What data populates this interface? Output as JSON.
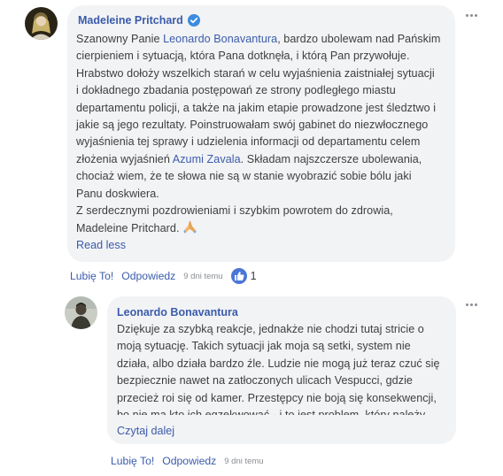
{
  "comment1": {
    "author": "Madeleine Pritchard",
    "lines": [
      {
        "segments": [
          {
            "text": "Szanowny Panie "
          },
          {
            "text": "Leonardo Bonavantura",
            "mention": true
          },
          {
            "text": ", bardzo ubolewam nad Pańskim"
          }
        ]
      },
      {
        "segments": [
          {
            "text": "cierpieniem i sytuacją, która Pana dotknęła, i którą Pan przywołuje."
          }
        ]
      },
      {
        "segments": [
          {
            "text": "Hrabstwo dołoży wszelkich starań w celu wyjaśnienia zaistniałej sytuacji"
          }
        ]
      },
      {
        "segments": [
          {
            "text": "i dokładnego zbadania postępowań ze strony podległego miastu"
          }
        ]
      },
      {
        "segments": [
          {
            "text": "departamentu policji, a także na jakim etapie prowadzone jest śledztwo i"
          }
        ]
      },
      {
        "segments": [
          {
            "text": "jakie są jego rezultaty. Poinstruowałam swój gabinet do niezwłocznego"
          }
        ]
      },
      {
        "segments": [
          {
            "text": "wyjaśnienia tej sprawy i udzielenia informacji od departamentu celem"
          }
        ]
      },
      {
        "segments": [
          {
            "text": "złożenia wyjaśnień "
          },
          {
            "text": "Azumi Zavala",
            "mention": true
          },
          {
            "text": ". Składam najszczersze ubolewania,"
          }
        ]
      },
      {
        "segments": [
          {
            "text": "chociaż wiem, że te słowa nie są w stanie wyobrazić sobie bólu jaki"
          }
        ]
      },
      {
        "segments": [
          {
            "text": "Panu doskwiera."
          }
        ]
      },
      {
        "segments": [
          {
            "text": "Z serdecznymi pozdrowieniami i szybkim powrotem do zdrowia,"
          }
        ]
      },
      {
        "segments": [
          {
            "text": "Madeleine Pritchard."
          }
        ],
        "emoji": "folded-hands"
      }
    ],
    "read_more": "Read less",
    "like_label": "Lubię To!",
    "reply_label": "Odpowiedz",
    "time": "9 dni temu",
    "like_count": "1"
  },
  "comment2": {
    "author": "Leonardo Bonavantura",
    "lines": [
      {
        "segments": [
          {
            "text": "Dziękuje za szybką reakcje, jednakże nie chodzi tutaj stricie o"
          }
        ]
      },
      {
        "segments": [
          {
            "text": "moją sytuację. Takich sytuacji jak moja są setki, system nie"
          }
        ]
      },
      {
        "segments": [
          {
            "text": "działa, albo działa bardzo źle. Ludzie nie mogą już teraz czuć się"
          }
        ]
      },
      {
        "segments": [
          {
            "text": "bezpiecznie nawet na zatłoczonych ulicach Vespucci, gdzie"
          }
        ]
      },
      {
        "segments": [
          {
            "text": "przecież roi się od kamer. Przestępcy nie boją się konsekwencji,"
          }
        ]
      },
      {
        "segments": [
          {
            "text": "bo nie ma kto ich egzekwować - i to jest problem, który należy"
          }
        ]
      }
    ],
    "read_more": "Czytaj dalej",
    "like_label": "Lubię To!",
    "reply_label": "Odpowiedz",
    "time": "9 dni temu"
  }
}
